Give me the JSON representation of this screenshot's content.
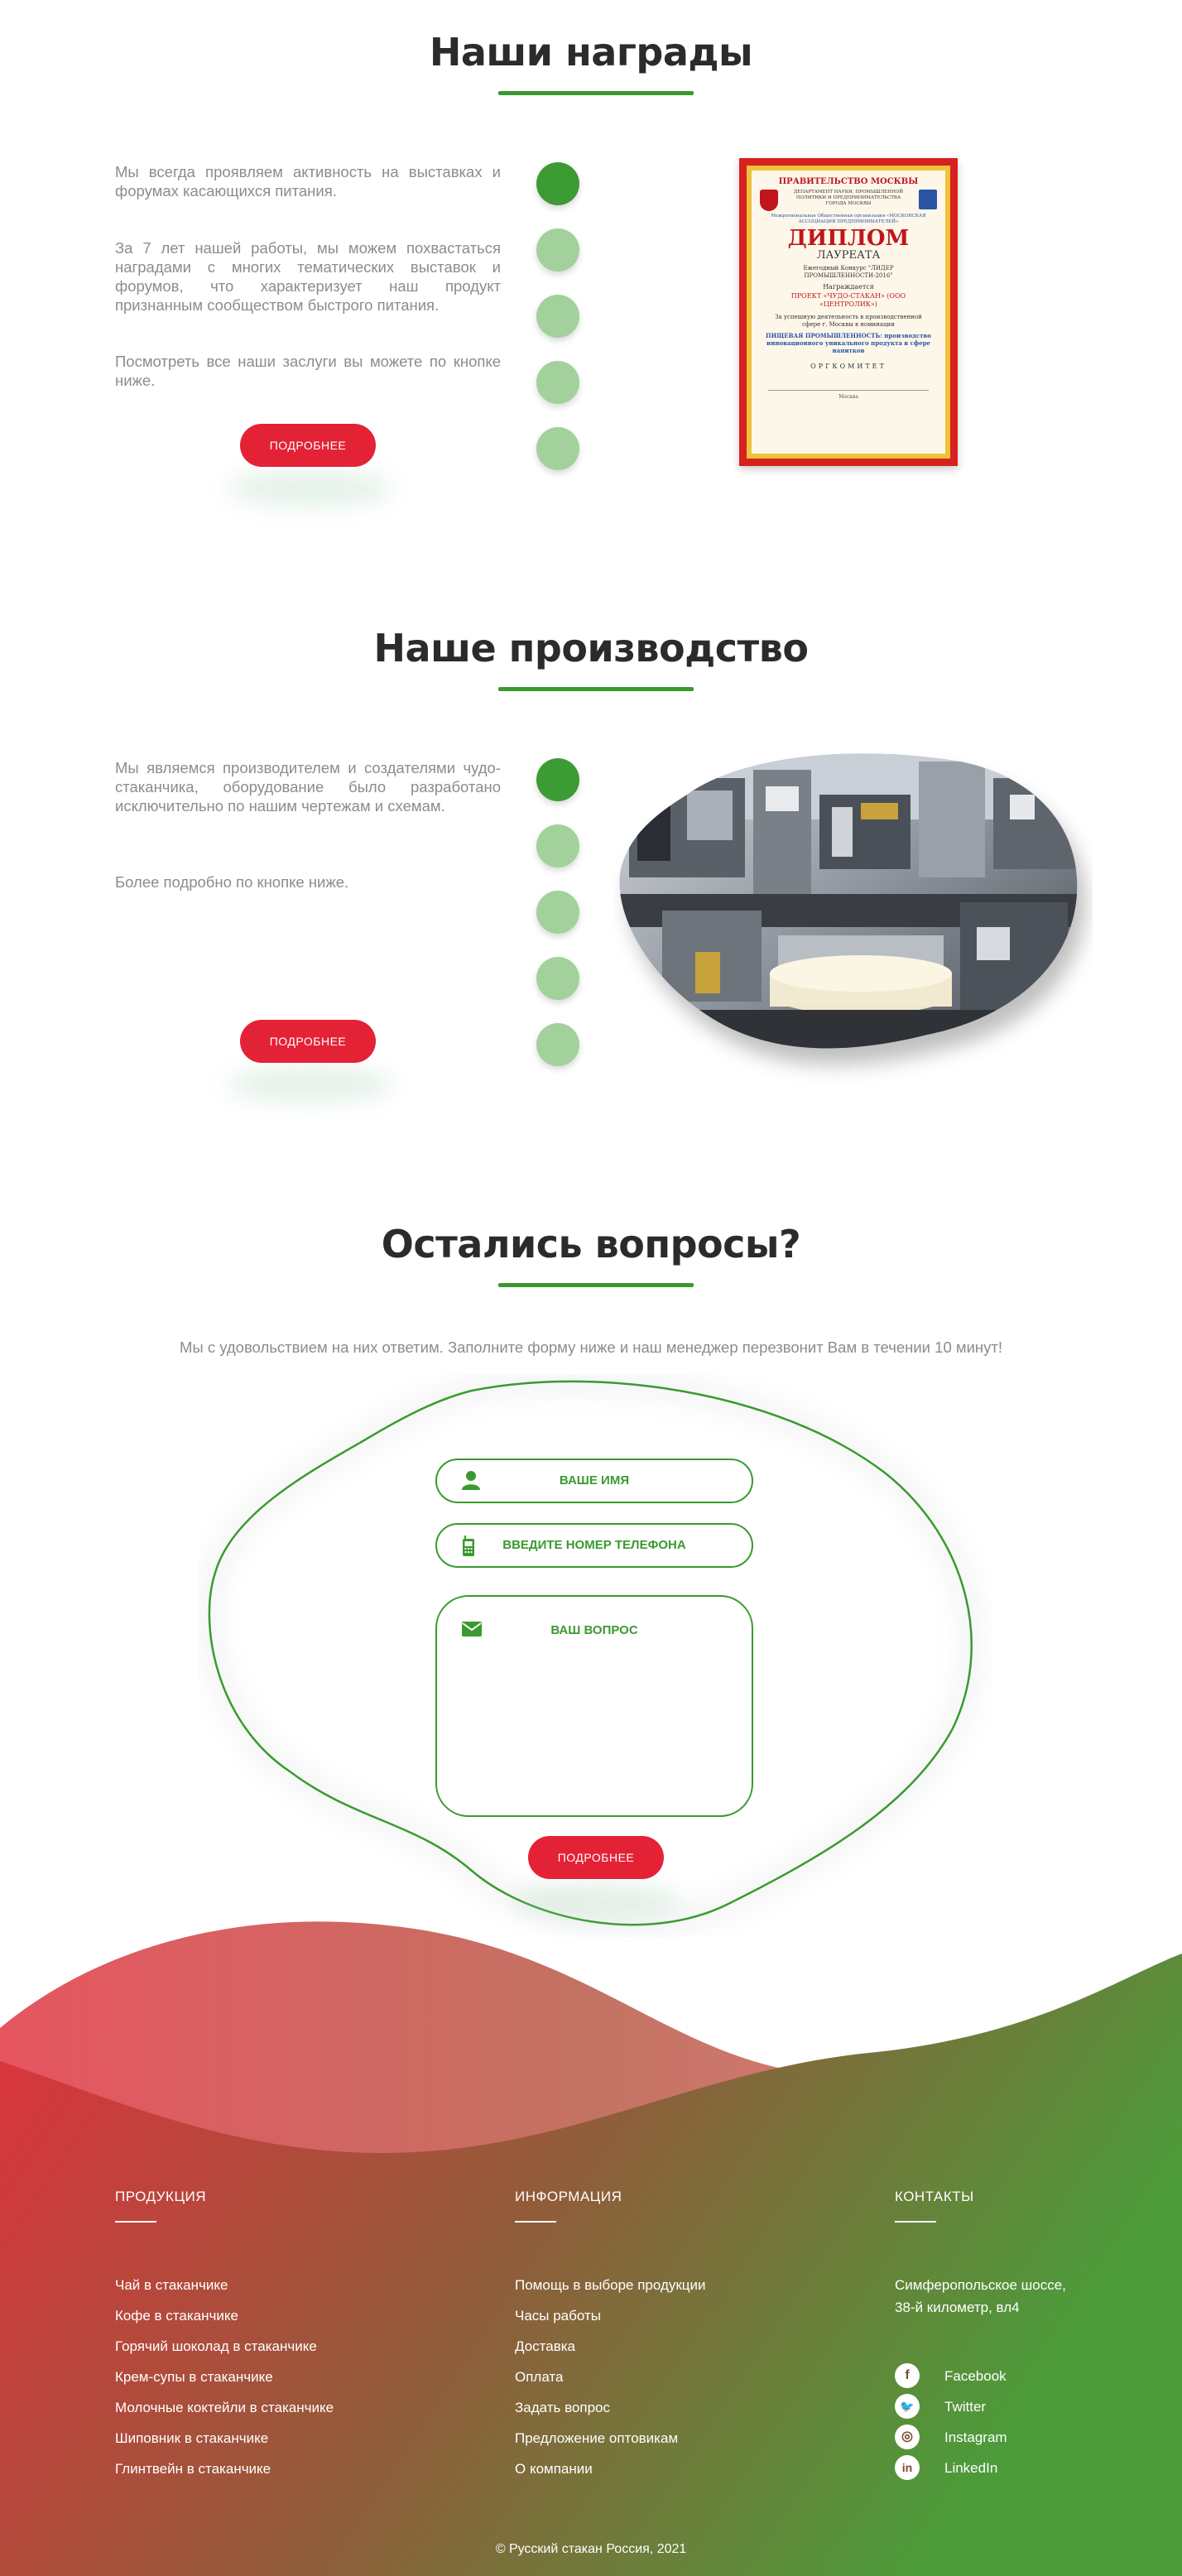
{
  "awards": {
    "title": "Наши награды",
    "p1": "Мы всегда проявляем активность на выставках и форумах касающихся питания.",
    "p2": "За 7 лет нашей работы, мы можем похвастаться наградами с многих тематических выставок и форумов, что характеризует наш продукт признанным сообществом быстрого питания.",
    "p3": "Посмотреть все наши заслуги вы можете по кнопке ниже.",
    "button": "ПОДРОБНЕЕ",
    "diploma": {
      "header": "ПРАВИТЕЛЬСТВО МОСКВЫ",
      "dept": "ДЕПАРТАМЕНТ НАУКИ, ПРОМЫШЛЕННОЙ ПОЛИТИКИ И ПРЕДПРИНИМАТЕЛЬСТВА ГОРОДА МОСКВЫ",
      "assoc": "Межрегиональная Общественная организация «МОСКОВСКАЯ АССОЦИАЦИЯ ПРЕДПРИНИМАТЕЛЕЙ»",
      "big": "ДИПЛОМ",
      "sub": "ЛАУРЕАТА",
      "contest": "Ежегодный Конкурс \"ЛИДЕР ПРОМЫШЛЕННОСТИ-2016\"",
      "awarded": "Награждается",
      "project": "ПРОЕКТ «ЧУДО-СТАКАН» (ООО «ЦЕНТРОЛИК»)",
      "merit": "За успешную деятельность в производственной сфере г. Москвы в номинации",
      "nomination": "ПИЩЕВАЯ ПРОМЫШЛЕННОСТЬ: производство инновационного уникального продукта в сфере напитков",
      "org": "ОРГКОМИТЕТ",
      "city": "Москва"
    }
  },
  "production": {
    "title": "Наше производство",
    "p1": "Мы являемся производителем и создателями чудо-стаканчика, оборудование было разработано исключительно по нашим чертежам и схемам.",
    "p2": "Более подробно по кнопке ниже.",
    "button": "ПОДРОБНЕЕ"
  },
  "questions": {
    "title": "Остались вопросы?",
    "subtitle": "Мы с удовольствием на них ответим.  Заполните форму ниже и наш менеджер перезвонит Вам в течении 10 минут!",
    "name_placeholder": "ВАШЕ ИМЯ",
    "phone_placeholder": "ВВЕДИТЕ НОМЕР ТЕЛЕФОНА",
    "question_placeholder": "ВАШ ВОПРОС",
    "button": "ПОДРОБНЕЕ"
  },
  "footer": {
    "products": {
      "heading": "ПРОДУКЦИЯ",
      "items": [
        "Чай в стаканчике",
        "Кофе в стаканчике",
        "Горячий шоколад в стаканчике",
        "Крем-супы в стаканчике",
        "Молочные коктейли в стаканчике",
        "Шиповник в стаканчике",
        "Глинтвейн в стаканчике"
      ]
    },
    "info": {
      "heading": "ИНФОРМАЦИЯ",
      "items": [
        "Помощь в выборе продукции",
        "Часы работы",
        "Доставка",
        "Оплата",
        "Задать вопрос",
        "Предложение оптовикам",
        "О компании"
      ]
    },
    "contacts": {
      "heading": "КОНТАКТЫ",
      "address_line1": "Симферопольское шоссе,",
      "address_line2": "38-й километр, вл4",
      "social": [
        {
          "name": "Facebook",
          "icon": "facebook-icon",
          "glyph": "f"
        },
        {
          "name": "Twitter",
          "icon": "twitter-icon",
          "glyph": "🐦"
        },
        {
          "name": "Instagram",
          "icon": "instagram-icon",
          "glyph": "◎"
        },
        {
          "name": "LinkedIn",
          "icon": "linkedin-icon",
          "glyph": "in"
        }
      ]
    },
    "copyright": "© Русский стакан Россия, 2021"
  },
  "colors": {
    "accent_green": "#3a9a2f",
    "dot_inactive": "#a2d19c",
    "button_red": "#e42236",
    "footer_red": "#e0323f",
    "footer_green": "#4f9a3a"
  }
}
